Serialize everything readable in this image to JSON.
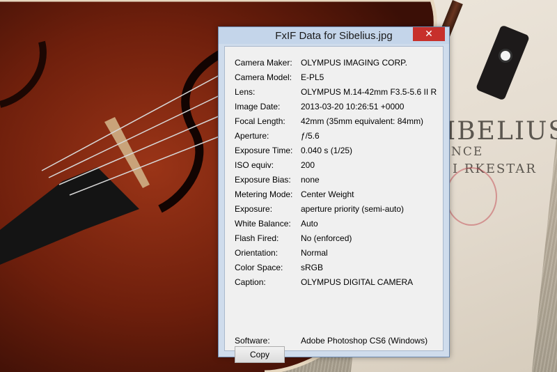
{
  "window": {
    "title": "FxIF Data for Sibelius.jpg",
    "close_icon": "close-icon",
    "close_glyph": "✕"
  },
  "background": {
    "paper_text_1": "IBELIUS",
    "paper_text_2": "NCE",
    "paper_text_3": "I  RKESTAR"
  },
  "exif": [
    {
      "label": "Camera Maker:",
      "value": "OLYMPUS IMAGING CORP."
    },
    {
      "label": "Camera Model:",
      "value": "E-PL5"
    },
    {
      "label": "Lens:",
      "value": "OLYMPUS M.14-42mm F3.5-5.6 II R"
    },
    {
      "label": "Image Date:",
      "value": "2013-03-20 10:26:51 +0000"
    },
    {
      "label": "Focal Length:",
      "value": "42mm (35mm equivalent: 84mm)"
    },
    {
      "label": "Aperture:",
      "value": "ƒ/5.6"
    },
    {
      "label": "Exposure Time:",
      "value": "0.040 s (1/25)"
    },
    {
      "label": "ISO equiv:",
      "value": "200"
    },
    {
      "label": "Exposure Bias:",
      "value": "none"
    },
    {
      "label": "Metering Mode:",
      "value": "Center Weight"
    },
    {
      "label": "Exposure:",
      "value": "aperture priority (semi-auto)"
    },
    {
      "label": "White Balance:",
      "value": "Auto"
    },
    {
      "label": "Flash Fired:",
      "value": "No (enforced)"
    },
    {
      "label": "Orientation:",
      "value": "Normal"
    },
    {
      "label": "Color Space:",
      "value": "sRGB"
    },
    {
      "label": "Caption:",
      "value": "OLYMPUS DIGITAL CAMERA"
    }
  ],
  "software": {
    "label": "Software:",
    "value": "Adobe Photoshop CS6 (Windows)"
  },
  "copy_button": "Copy",
  "colors": {
    "close_button": "#c7302b",
    "titlebar": "#c4d5ea"
  }
}
